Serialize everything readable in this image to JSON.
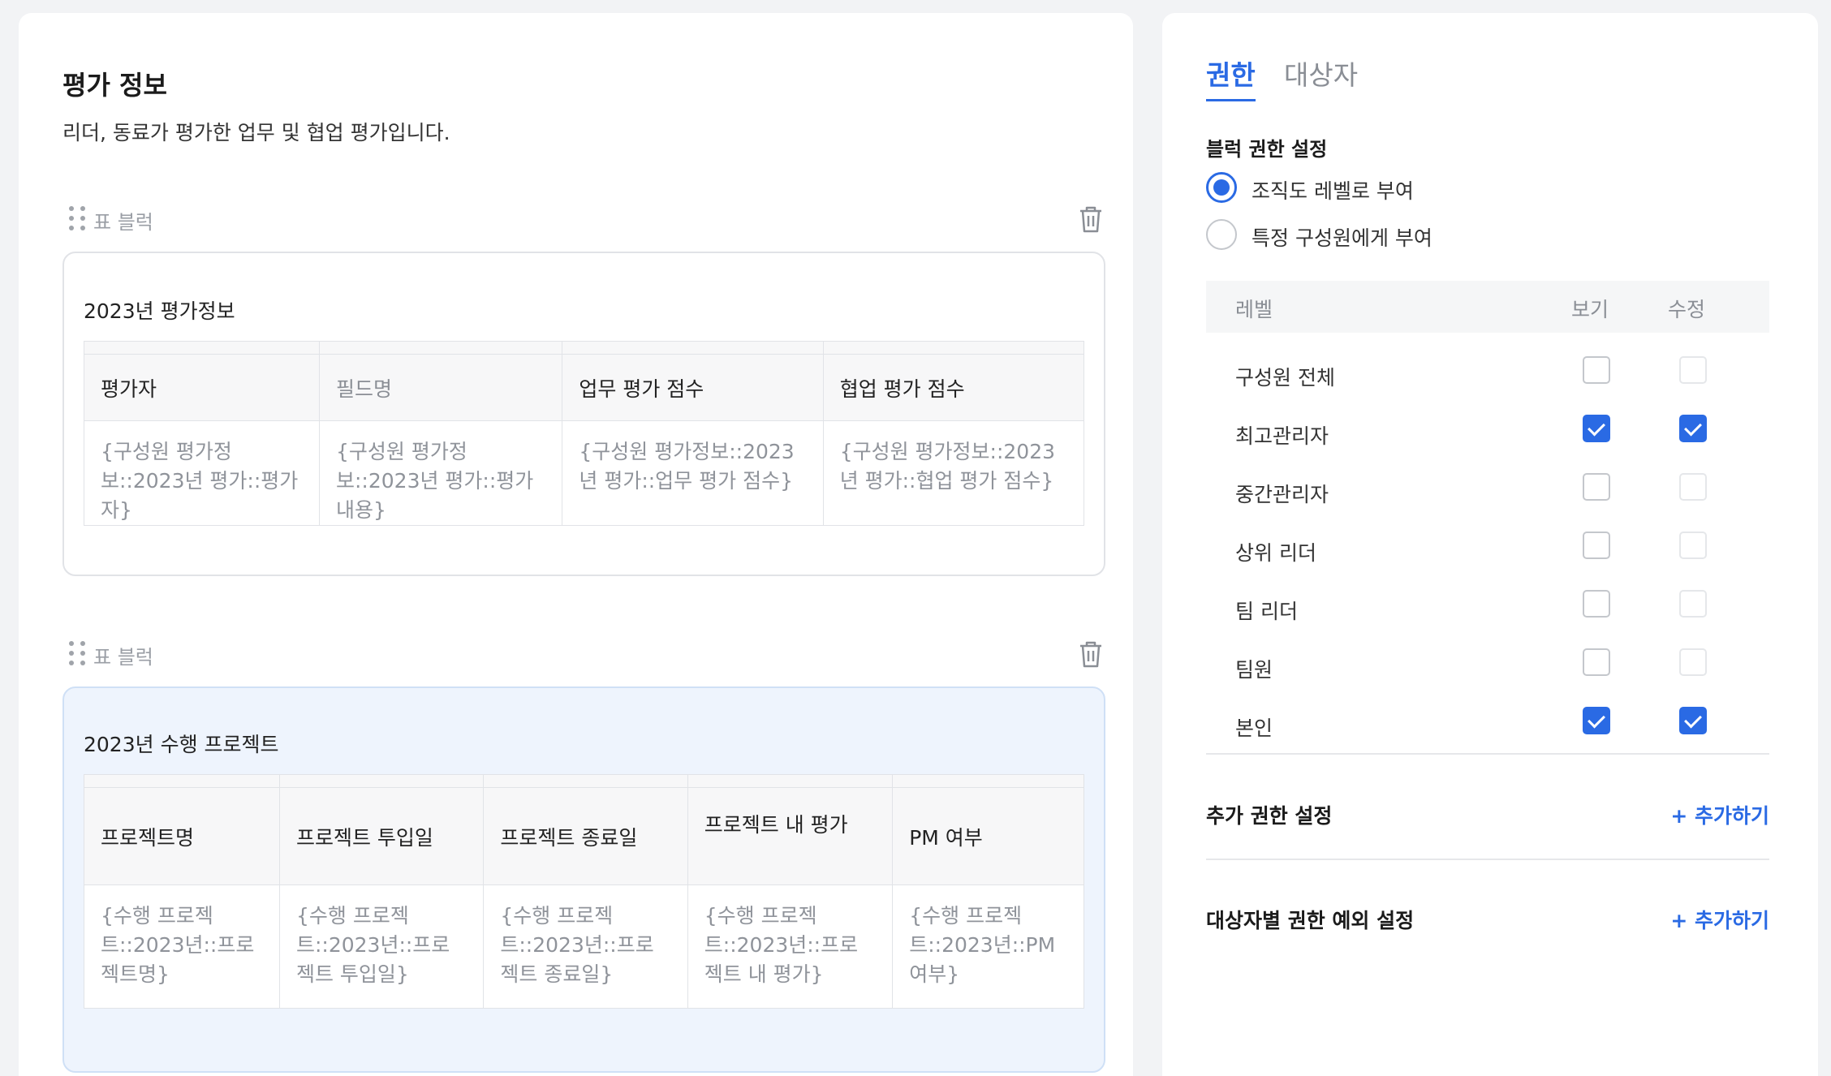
{
  "evaluation": {
    "title": "평가 정보",
    "description": "리더, 동료가 평가한 업무 및 협업 평가입니다."
  },
  "blocks": [
    {
      "label": "표 블럭",
      "table_title": "2023년 평가정보",
      "headers": [
        "평가자",
        "필드명",
        "업무 평가 점수",
        "협업 평가 점수"
      ],
      "rows": [
        [
          "{구성원 평가정보::2023년 평가::평가자}",
          "{구성원 평가정보::2023년 평가::평가내용}",
          "{구성원 평가정보::2023년 평가::업무 평가 점수}",
          "{구성원 평가정보::2023년 평가::협업 평가 점수}"
        ]
      ]
    },
    {
      "label": "표 블럭",
      "table_title": "2023년 수행 프로젝트",
      "headers": [
        "프로젝트명",
        "프로젝트 투입일",
        "프로젝트 종료일",
        "프로젝트 내 평가",
        "PM 여부"
      ],
      "rows": [
        [
          "{수행 프로젝트::2023년::프로젝트명}",
          "{수행 프로젝트::2023년::프로젝트 투입일}",
          "{수행 프로젝트::2023년::프로젝트 종료일}",
          "{수행 프로젝트::2023년::프로젝트 내 평가}",
          "{수행 프로젝트::2023년::PM 여부}"
        ]
      ]
    }
  ],
  "tabs": [
    "권한",
    "대상자"
  ],
  "permissions": {
    "heading": "블럭 권한 설정",
    "options": [
      {
        "label": "조직도 레벨로 부여",
        "selected": true
      },
      {
        "label": "특정 구성원에게 부여",
        "selected": false
      }
    ],
    "columns": {
      "level": "레벨",
      "view": "보기",
      "edit": "수정"
    },
    "levels": [
      {
        "name": "구성원 전체",
        "view": false,
        "edit": false,
        "edit_disabled": true
      },
      {
        "name": "최고관리자",
        "view": true,
        "edit": true,
        "edit_disabled": false
      },
      {
        "name": "중간관리자",
        "view": false,
        "edit": false,
        "edit_disabled": true
      },
      {
        "name": "상위 리더",
        "view": false,
        "edit": false,
        "edit_disabled": true
      },
      {
        "name": "팀 리더",
        "view": false,
        "edit": false,
        "edit_disabled": true
      },
      {
        "name": "팀원",
        "view": false,
        "edit": false,
        "edit_disabled": true
      },
      {
        "name": "본인",
        "view": true,
        "edit": true,
        "edit_disabled": false
      }
    ]
  },
  "extra": {
    "additional_title": "추가 권한 설정",
    "exception_title": "대상자별 권한 예외 설정",
    "add_label": "+ 추가하기"
  },
  "colors": {
    "accent": "#2a6ae4",
    "active_block_bg": "#eef4fd"
  }
}
